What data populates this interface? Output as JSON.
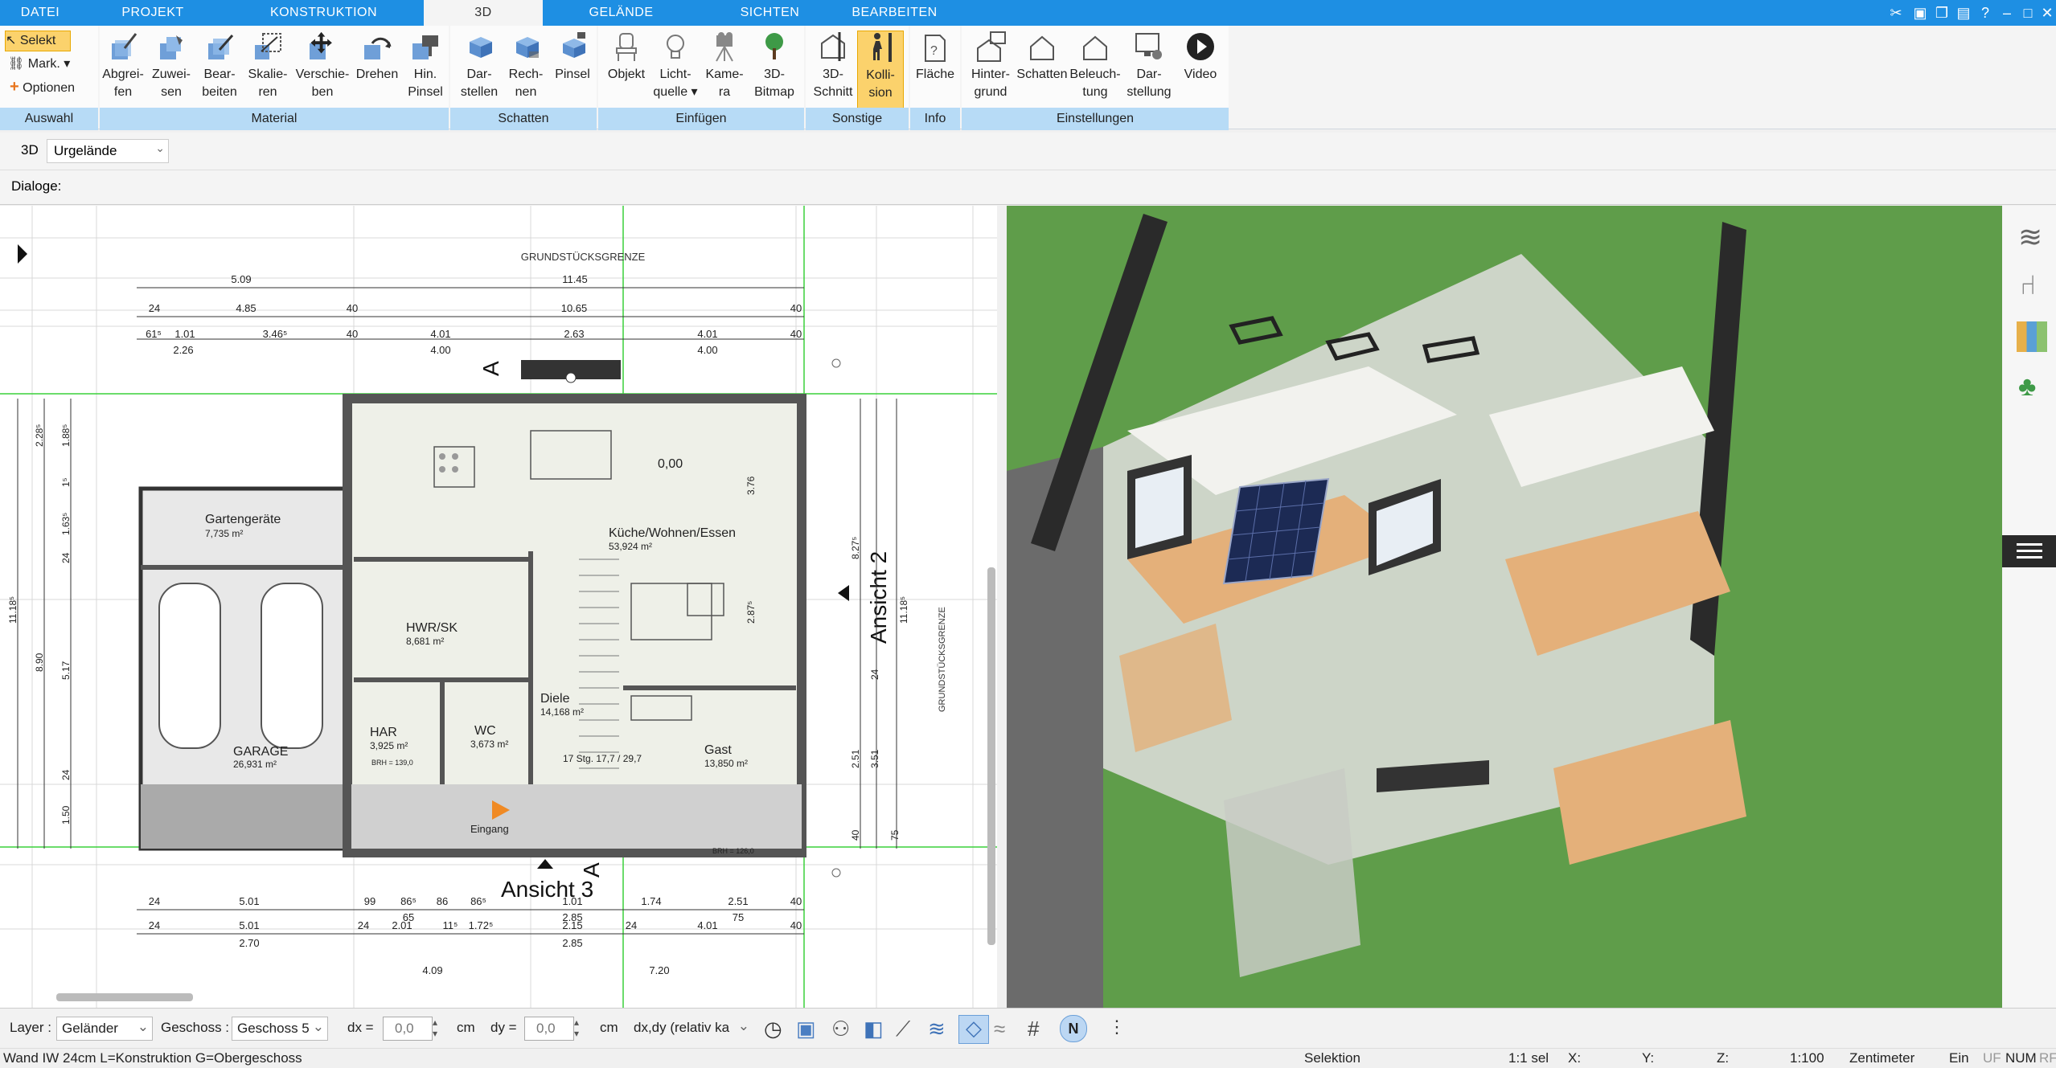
{
  "menu": {
    "tabs": [
      "DATEI",
      "PROJEKT",
      "KONSTRUKTION",
      "3D",
      "GELÄNDE",
      "SICHTEN",
      "BEARBEITEN"
    ],
    "active": "3D"
  },
  "ribbon": {
    "auswahl": {
      "select": "Selekt",
      "mark": "Mark.",
      "options": "Optionen",
      "label": "Auswahl"
    },
    "material": {
      "label": "Material",
      "buttons": [
        {
          "l1": "Abgrei-",
          "l2": "fen"
        },
        {
          "l1": "Zuwei-",
          "l2": "sen"
        },
        {
          "l1": "Bear-",
          "l2": "beiten"
        },
        {
          "l1": "Skalie-",
          "l2": "ren"
        },
        {
          "l1": "Verschie-",
          "l2": "ben"
        },
        {
          "l1": "Drehen",
          "l2": ""
        },
        {
          "l1": "Hin.",
          "l2": "Pinsel"
        }
      ]
    },
    "schatten": {
      "label": "Schatten",
      "buttons": [
        {
          "l1": "Dar-",
          "l2": "stellen"
        },
        {
          "l1": "Rech-",
          "l2": "nen"
        },
        {
          "l1": "Pinsel",
          "l2": ""
        }
      ]
    },
    "einfuegen": {
      "label": "Einfügen",
      "buttons": [
        {
          "l1": "Objekt",
          "l2": ""
        },
        {
          "l1": "Licht-",
          "l2": "quelle ▾"
        },
        {
          "l1": "Kame-",
          "l2": "ra"
        },
        {
          "l1": "3D-",
          "l2": "Bitmap"
        }
      ]
    },
    "sonstige": {
      "label": "Sonstige",
      "buttons": [
        {
          "l1": "3D-",
          "l2": "Schnitt"
        },
        {
          "l1": "Kolli-",
          "l2": "sion"
        }
      ]
    },
    "info": {
      "label": "Info",
      "buttons": [
        {
          "l1": "Fläche",
          "l2": ""
        }
      ]
    },
    "einstellungen": {
      "label": "Einstellungen",
      "buttons": [
        {
          "l1": "Hinter-",
          "l2": "grund"
        },
        {
          "l1": "Schatten",
          "l2": ""
        },
        {
          "l1": "Beleuch-",
          "l2": "tung"
        },
        {
          "l1": "Dar-",
          "l2": "stellung"
        },
        {
          "l1": "Video",
          "l2": ""
        }
      ]
    }
  },
  "viewbar": {
    "mode": "3D",
    "terrain": "Urgelände"
  },
  "dialogs": {
    "label": "Dialoge:"
  },
  "plan": {
    "boundary_top": "GRUNDSTÜCKSGRENZE",
    "boundary_right": "GRUNDSTÜCKSGRENZE",
    "dims_top_row1": [
      "5.09",
      "11.45"
    ],
    "dims_top_row2": [
      "24",
      "4.85",
      "40",
      "10.65",
      "40"
    ],
    "dims_top_row3": [
      "61⁵",
      "1.01",
      "3.46⁵",
      "40",
      "4.01",
      "2.63",
      "4.01",
      "40"
    ],
    "dims_top_row4": [
      "2.26",
      "4.00",
      "4.00"
    ],
    "rooms": [
      {
        "name": "Gartengeräte",
        "area": "7,735 m²"
      },
      {
        "name": "Küche/Wohnen/Essen",
        "area": "53,924 m²"
      },
      {
        "name": "HWR/SK",
        "area": "8,681 m²"
      },
      {
        "name": "Diele",
        "area": "14,168 m²"
      },
      {
        "name": "HAR",
        "area": "3,925 m²"
      },
      {
        "name": "WC",
        "area": "3,673 m²"
      },
      {
        "name": "Gast",
        "area": "13,850 m²"
      },
      {
        "name": "GARAGE",
        "area": "26,931 m²"
      }
    ],
    "level": "0,00",
    "stairs": "17 Stg. 17,7 / 29,7",
    "entry": "Eingang",
    "view2": "Ansicht 2",
    "view3": "Ansicht 3",
    "section": "A",
    "brh1": "BRH = 139,0",
    "brh2": "BRH = 126,0",
    "dims_left": [
      "11.18⁵",
      "8.90",
      "2.28⁵",
      "1.88⁵",
      "1⁵",
      "1.63⁵",
      "24",
      "5.17",
      "24",
      "1.50"
    ],
    "dims_right": [
      "11.18⁵",
      "8.27⁵",
      "3.76",
      "2.87⁵",
      "24",
      "2.51",
      "3.51",
      "40",
      "75"
    ],
    "dims_bottom_row1": [
      "24",
      "5.01",
      "99",
      "86⁵",
      "86",
      "86⁵",
      "1.01",
      "1.74",
      "2.51",
      "40"
    ],
    "dims_bottom_row2": [
      "65",
      "2.85",
      "75"
    ],
    "dims_bottom_row3": [
      "24",
      "5.01",
      "24",
      "2.01",
      "11⁵",
      "1.72⁵",
      "2.15",
      "24",
      "4.01",
      "40"
    ],
    "dims_bottom_row4": [
      "2.70",
      "2.85"
    ],
    "dims_bottom_row5": [
      "4.09",
      "7.20"
    ]
  },
  "toolbar": {
    "layer_label": "Layer :",
    "layer_value": "Geländer",
    "floor_label": "Geschoss :",
    "floor_value": "Geschoss 5",
    "dx_label": "dx =",
    "dx_value": "0,0",
    "dx_unit": "cm",
    "dy_label": "dy =",
    "dy_value": "0,0",
    "dy_unit": "cm",
    "coord_mode": "dx,dy (relativ ka"
  },
  "status": {
    "left": "Wand IW 24cm L=Konstruktion G=Obergeschoss",
    "mode": "Selektion",
    "sel": "1:1 sel",
    "x": "X:",
    "y": "Y:",
    "z": "Z:",
    "scale": "1:100",
    "unit": "Zentimeter",
    "ein": "Ein",
    "uf": "UF",
    "num": "NUM",
    "rf": "RF"
  },
  "colors": {
    "tabbar": "#1e8fe3",
    "group_label": "#b7dbf6",
    "grass": "#5a9a48",
    "active_button": "#fbd26c"
  }
}
